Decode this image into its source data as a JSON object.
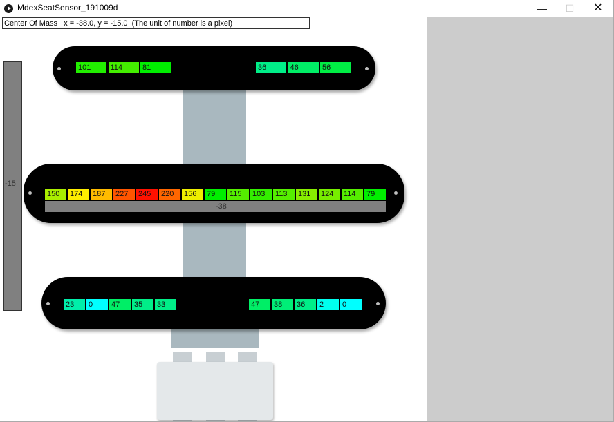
{
  "window": {
    "title": "MdexSeatSensor_191009d"
  },
  "window_controls": {
    "minimize": "—",
    "maximize": "☐",
    "close": "✕"
  },
  "center_of_mass": {
    "text": "Center Of Mass   x = -38.0, y = -15.0  (The unit of number is a pixel)"
  },
  "y_axis": {
    "label": "-15"
  },
  "x_axis": {
    "label": "-38"
  },
  "rows": {
    "top_left": [
      {
        "value": "101",
        "color": "#22ee00"
      },
      {
        "value": "114",
        "color": "#44ee00"
      },
      {
        "value": "81",
        "color": "#00ee00"
      }
    ],
    "top_right": [
      {
        "value": "36",
        "color": "#00ee88"
      },
      {
        "value": "46",
        "color": "#00ee66"
      },
      {
        "value": "56",
        "color": "#00ee44"
      }
    ],
    "middle": [
      {
        "value": "150",
        "color": "#aaee00"
      },
      {
        "value": "174",
        "color": "#ffee00"
      },
      {
        "value": "187",
        "color": "#ffbb00"
      },
      {
        "value": "227",
        "color": "#ff5500"
      },
      {
        "value": "245",
        "color": "#ff1100"
      },
      {
        "value": "220",
        "color": "#ff6600"
      },
      {
        "value": "156",
        "color": "#eeee00"
      },
      {
        "value": "79",
        "color": "#00ee00"
      },
      {
        "value": "115",
        "color": "#55ee00"
      },
      {
        "value": "103",
        "color": "#33ee00"
      },
      {
        "value": "113",
        "color": "#55ee00"
      },
      {
        "value": "131",
        "color": "#88ee00"
      },
      {
        "value": "124",
        "color": "#77ee00"
      },
      {
        "value": "114",
        "color": "#55ee00"
      },
      {
        "value": "79",
        "color": "#00ee00"
      }
    ],
    "bottom_left": [
      {
        "value": "23",
        "color": "#00eeaa"
      },
      {
        "value": "0",
        "color": "#00ffff"
      },
      {
        "value": "47",
        "color": "#00ee66"
      },
      {
        "value": "35",
        "color": "#00ee88"
      },
      {
        "value": "33",
        "color": "#00ee88"
      }
    ],
    "bottom_right": [
      {
        "value": "47",
        "color": "#00ee66"
      },
      {
        "value": "38",
        "color": "#00ee77"
      },
      {
        "value": "36",
        "color": "#00ee88"
      },
      {
        "value": "2",
        "color": "#00ffee"
      },
      {
        "value": "0",
        "color": "#00ffff"
      }
    ]
  }
}
